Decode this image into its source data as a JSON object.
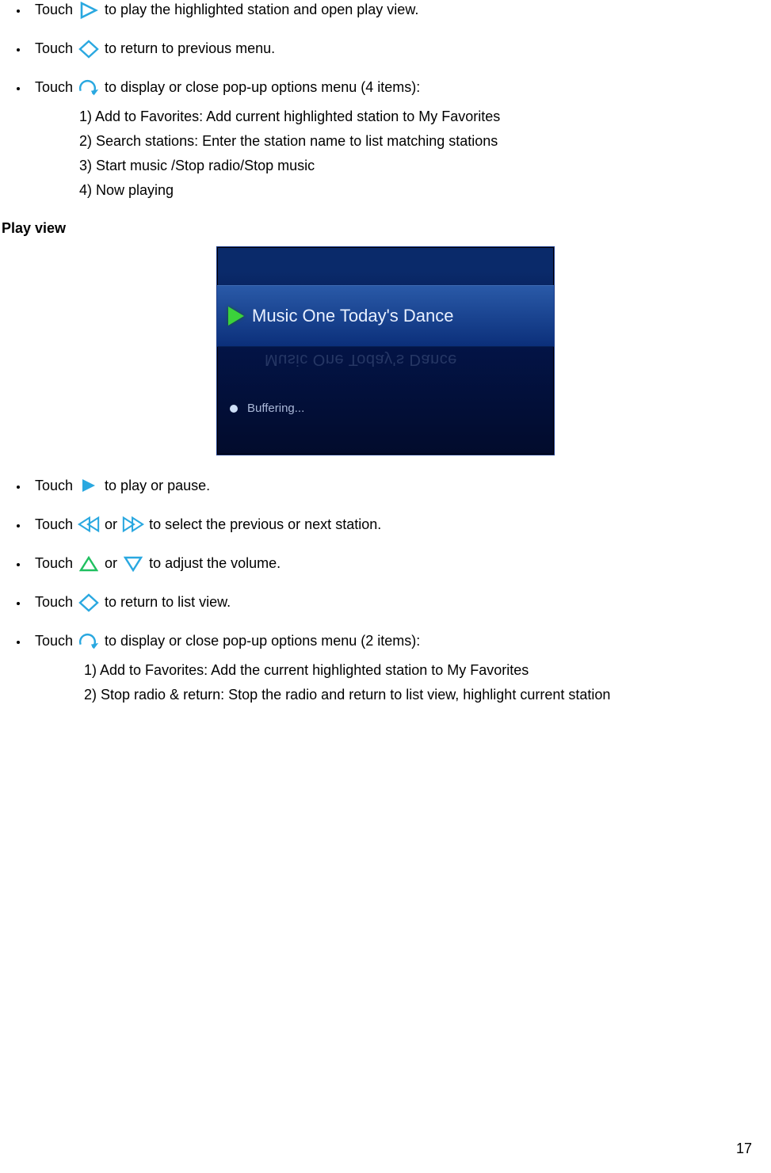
{
  "section1": {
    "items": [
      {
        "pre": "Touch",
        "icon": "play-outline",
        "post": " to play the highlighted station and open play view."
      },
      {
        "pre": "Touch",
        "icon": "back-diamond",
        "post": " to return to previous menu."
      },
      {
        "pre": "Touch",
        "icon": "options-arrow",
        "post": " to display or close pop-up options menu (4 items):"
      }
    ],
    "sublist": [
      "Add to Favorites: Add current highlighted station to My Favorites",
      "Search stations: Enter the station name to list matching stations",
      "Start music /Stop radio/Stop music",
      "Now playing"
    ]
  },
  "heading": "Play view",
  "screenshot": {
    "title": "Music One Today's Dance",
    "reflect": "Music One Today's Dance",
    "status": "Buffering..."
  },
  "section2": {
    "items": [
      {
        "parts": [
          {
            "t": "Touch "
          },
          {
            "icon": "play-solid"
          },
          {
            "t": "to play or pause."
          }
        ]
      },
      {
        "parts": [
          {
            "t": "Touch "
          },
          {
            "icon": "prev"
          },
          {
            "t": " or "
          },
          {
            "icon": "next"
          },
          {
            "t": " to select the previous or next station."
          }
        ]
      },
      {
        "parts": [
          {
            "t": "Touch "
          },
          {
            "icon": "vol-up"
          },
          {
            "t": " or "
          },
          {
            "icon": "vol-down"
          },
          {
            "t": " to adjust the volume."
          }
        ]
      },
      {
        "parts": [
          {
            "t": "Touch "
          },
          {
            "icon": "back-diamond"
          },
          {
            "t": " to return to list view."
          }
        ]
      },
      {
        "parts": [
          {
            "t": "Touch "
          },
          {
            "icon": "options-arrow"
          },
          {
            "t": " to display or close pop-up options menu (2 items):"
          }
        ]
      }
    ],
    "sublist": [
      "Add to Favorites: Add the current highlighted station to My Favorites",
      "Stop radio & return: Stop the radio and return to list view, highlight current station"
    ]
  },
  "pageNumber": "17",
  "icons": {
    "play-outline": "play-outline-icon",
    "back-diamond": "back-diamond-icon",
    "options-arrow": "options-arrow-icon",
    "play-solid": "play-solid-icon",
    "prev": "prev-icon",
    "next": "next-icon",
    "vol-up": "vol-up-icon",
    "vol-down": "vol-down-icon"
  }
}
